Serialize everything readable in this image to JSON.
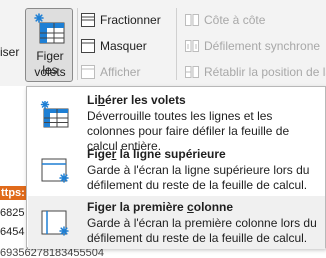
{
  "ribbon": {
    "left_partial_label": "iser",
    "figer_volets": {
      "line1": "Figer les",
      "line2": "volets ⌄"
    },
    "group1": [
      {
        "label": "Fractionner",
        "icon": "split-icon",
        "disabled": false
      },
      {
        "label": "Masquer",
        "icon": "hide-window-icon",
        "disabled": false
      },
      {
        "label": "Afficher",
        "icon": "unhide-window-icon",
        "disabled": true
      }
    ],
    "group2": [
      {
        "label": "Côte à côte",
        "icon": "side-by-side-icon",
        "disabled": true
      },
      {
        "label": "Défilement synchrone",
        "icon": "sync-scroll-icon",
        "disabled": true
      },
      {
        "label": "Rétablir la position de la",
        "icon": "reset-position-icon",
        "disabled": true
      }
    ]
  },
  "sheet": {
    "highlighted_cell": "ttps:",
    "cell_row1": "6825",
    "cell_row2": "6454",
    "cell_bottom": "69356278183455504"
  },
  "menu": {
    "items": [
      {
        "title_pre": "Li",
        "title_u": "b",
        "title_post": "érer les volets",
        "description": "Déverrouille toutes les lignes et les colonnes pour faire défiler la feuille de calcul entière.",
        "icon": "unfreeze-panes-icon"
      },
      {
        "title_pre": "Fige",
        "title_u": "r",
        "title_post": " la ligne supérieure",
        "description": "Garde à l'écran la ligne supérieure lors du défilement du reste de la feuille de calcul.",
        "icon": "freeze-top-row-icon"
      },
      {
        "title_pre": "Figer la première ",
        "title_u": "c",
        "title_post": "olonne",
        "description": "Garde à l'écran la première colonne lors du défilement du reste de la feuille de calcul.",
        "icon": "freeze-first-column-icon"
      }
    ]
  },
  "colors": {
    "accent_blue": "#1e7fd4",
    "highlight_orange": "#e06a1a"
  }
}
